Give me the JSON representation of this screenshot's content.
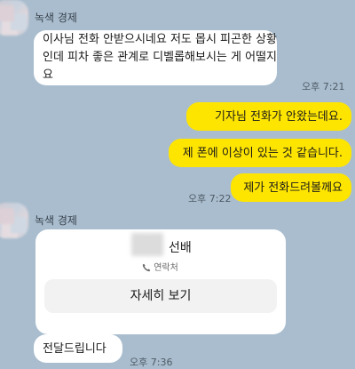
{
  "chat": {
    "sender_name": "녹색 경제",
    "messages": {
      "m1": {
        "line1": "이사님 전화 안받으시네요 저도 몹시 피곤한 상황",
        "line2": "인데 피차 좋은 관계로 디벨롭해보시는 게 어떨지",
        "line3": "요",
        "time": "오후 7:21"
      },
      "m2": {
        "text": "기자님 전화가 안왔는데요."
      },
      "m3": {
        "text": "제 폰에 이상이 있는 것 같습니다."
      },
      "m4": {
        "text": "제가 전화드려볼께요",
        "time": "오후 7:22"
      },
      "contact_card": {
        "name": "선배",
        "contact_label": "연락처",
        "contact_icon": "phone-icon",
        "button_label": "자세히 보기"
      },
      "m5": {
        "text": "전달드립니다",
        "time": "오후 7:36"
      }
    }
  },
  "colors": {
    "background": "#a9bdce",
    "outgoing_bubble": "#fee500",
    "incoming_bubble": "#ffffff"
  }
}
